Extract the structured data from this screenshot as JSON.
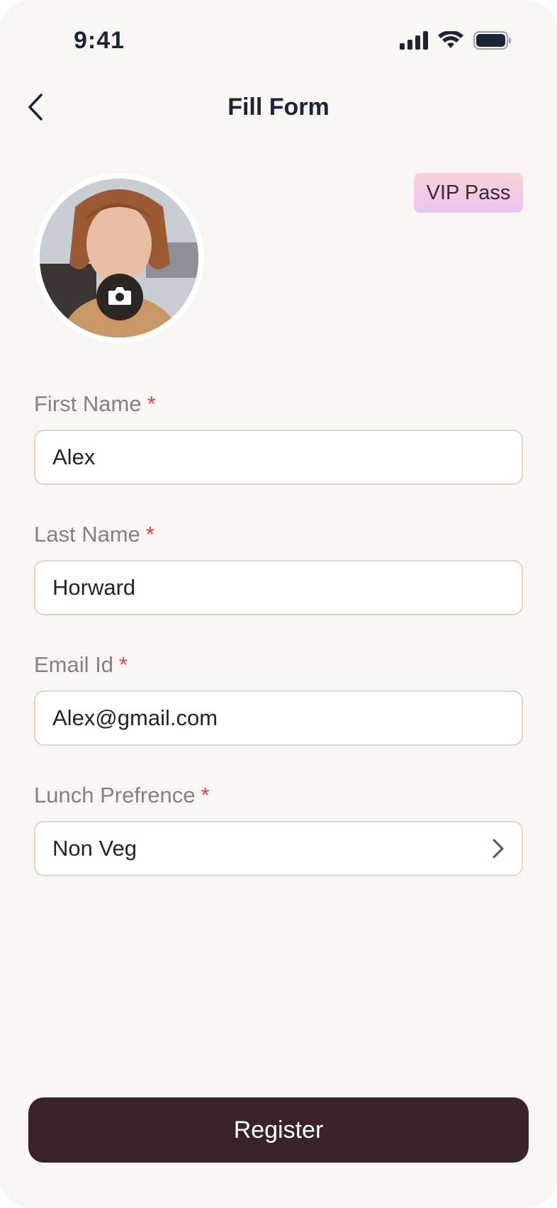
{
  "status_bar": {
    "time": "9:41",
    "icons": [
      "signal-icon",
      "wifi-icon",
      "battery-icon"
    ]
  },
  "nav": {
    "back_icon": "chevron-left-icon",
    "title": "Fill Form"
  },
  "profile": {
    "avatar_alt": "profile-photo",
    "camera_icon": "camera-icon",
    "badge": "VIP Pass"
  },
  "form": {
    "first_name": {
      "label": "First Name",
      "required": "*",
      "value": "Alex"
    },
    "last_name": {
      "label": "Last Name",
      "required": "*",
      "value": "Horward"
    },
    "email": {
      "label": "Email Id",
      "required": "*",
      "value": "Alex@gmail.com"
    },
    "lunch": {
      "label": "Lunch Prefrence",
      "required": "*",
      "value": "Non Veg",
      "icon": "chevron-right-icon"
    }
  },
  "actions": {
    "register_label": "Register"
  },
  "colors": {
    "background": "#f8f6f3",
    "primary_button": "#382523",
    "required": "#e0463a",
    "input_border": "#e2d3c7"
  }
}
